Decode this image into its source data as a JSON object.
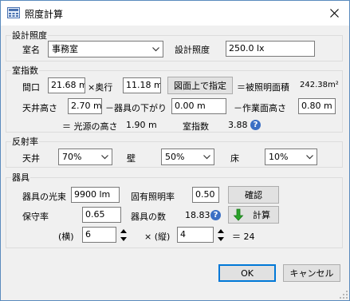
{
  "title": "照度計算",
  "icons": {
    "app": "calculator-app-icon",
    "close": "close-icon",
    "help": "help-icon",
    "arrow": "green-down-arrow-icon"
  },
  "design": {
    "legend": "設計照度",
    "room_label": "室名",
    "room_value": "事務室",
    "illuminance_label": "設計照度",
    "illuminance_value": "250.0 lx"
  },
  "room_index": {
    "legend": "室指数",
    "frontage_label": "間口",
    "frontage_value": "21.68 m",
    "times_depth_label": "×奥行",
    "depth_value": "11.18 m",
    "specify_button": "図面上で指定",
    "area_label": "＝被照明面積",
    "area_value": "242.38m²",
    "ceiling_height_label": "天井高さ",
    "ceiling_height_value": "2.70 m",
    "fixture_drop_label": "－器具の下がり",
    "fixture_drop_value": "0.00 m",
    "work_height_label": "－作業面高さ",
    "work_height_value": "0.80 m",
    "light_height_label": "＝ 光源の高さ",
    "light_height_value": "1.90 m",
    "room_index_label": "室指数",
    "room_index_value": "3.88"
  },
  "reflectance": {
    "legend": "反射率",
    "ceiling_label": "天井",
    "ceiling_value": "70%",
    "wall_label": "壁",
    "wall_value": "50%",
    "floor_label": "床",
    "floor_value": "10%"
  },
  "fixture": {
    "legend": "器具",
    "flux_label": "器具の光束",
    "flux_value": "9900 lm",
    "util_label": "固有照明率",
    "util_value": "0.50",
    "confirm_button": "確認",
    "maint_label": "保守率",
    "maint_value": "0.65",
    "count_label": "器具の数",
    "count_value": "18.83",
    "calc_button": "計算",
    "horiz_label": "(横)",
    "horiz_value": "6",
    "vert_label": "× (縦)",
    "vert_value": "4",
    "total_label": "＝ 24"
  },
  "buttons": {
    "ok": "OK",
    "cancel": "キャンセル"
  }
}
